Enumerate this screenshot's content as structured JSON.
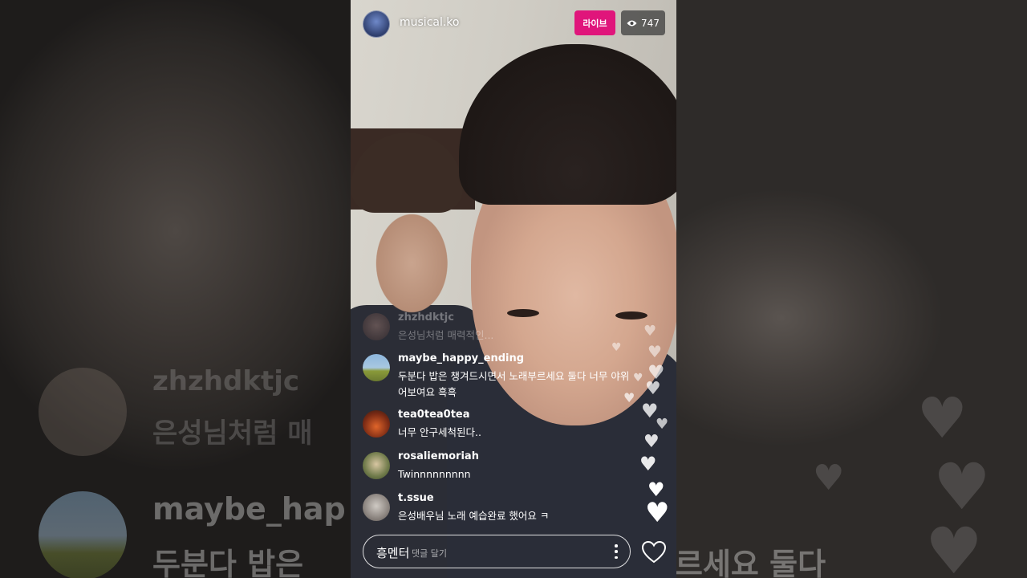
{
  "header": {
    "username": "musical.ko",
    "live_label": "라이브",
    "viewer_count": "747"
  },
  "comments": [
    {
      "username": "zhzhdktjc",
      "text": "은성님처럼 매력적인..."
    },
    {
      "username": "maybe_happy_ending",
      "text": "두분다 밥은 챙겨드시면서 노래부르세요 둘다 너무 야위어보여요 흑흑"
    },
    {
      "username": "tea0tea0tea",
      "text": "너무 안구세척된다.."
    },
    {
      "username": "rosaliemoriah",
      "text": "Twinnnnnnnnn"
    },
    {
      "username": "t.ssue",
      "text": "은성배우님 노래 예습완료 했어요 ㅋ"
    }
  ],
  "composer": {
    "typed_text": "흥멘터",
    "placeholder": "댓글 달기"
  },
  "background_mirror": {
    "ghost_username_1": "zhzhdktjc",
    "ghost_text_1": "은성님처럼 매",
    "ghost_username_2": "maybe_hap",
    "ghost_text_2": "두분다 밥은",
    "ghost_text_right": "르세요 둘다"
  },
  "colors": {
    "live_badge": "#e0157b",
    "text": "#ffffff"
  },
  "icons": {
    "viewers": "eye-icon",
    "more": "more-vertical-icon",
    "like": "heart-outline-icon"
  }
}
